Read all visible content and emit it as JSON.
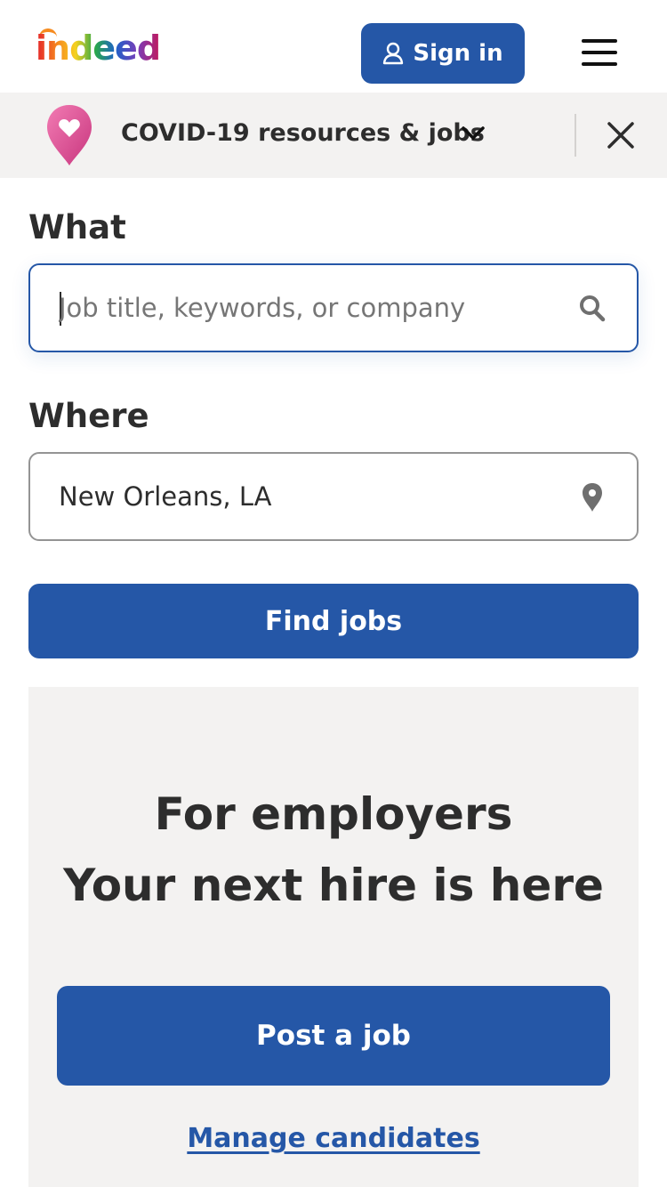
{
  "header": {
    "logo_text": "indeed",
    "signin_label": "Sign in"
  },
  "banner": {
    "text": "COVID-19 resources & jobs"
  },
  "search": {
    "what_label": "What",
    "what_placeholder": "Job title, keywords, or company",
    "what_value": "",
    "where_label": "Where",
    "where_value": "New Orleans, LA",
    "find_button": "Find jobs"
  },
  "employers": {
    "title_line1": "For employers",
    "title_line2": "Your next hire is here",
    "post_button": "Post a job",
    "manage_link": "Manage candidates"
  },
  "colors": {
    "primary": "#2557a7",
    "banner_bg": "#f3f2f1",
    "text": "#2d2d2d"
  },
  "icons": [
    "user-icon",
    "menu-icon",
    "heart-pin-icon",
    "chevron-down-icon",
    "close-icon",
    "search-icon",
    "location-pin-icon"
  ]
}
